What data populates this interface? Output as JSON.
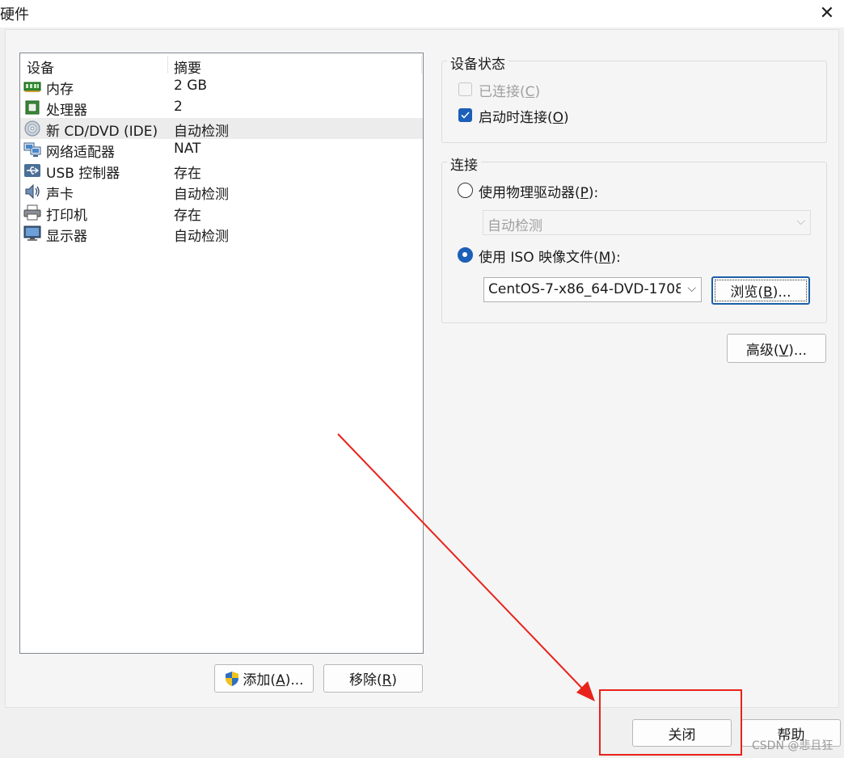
{
  "window": {
    "title": "硬件",
    "close_icon": "close-icon"
  },
  "device_list": {
    "columns": {
      "device": "设备",
      "summary": "摘要"
    },
    "items": [
      {
        "name": "内存",
        "summary": "2 GB",
        "icon": "memory-icon"
      },
      {
        "name": "处理器",
        "summary": "2",
        "icon": "processor-icon"
      },
      {
        "name": "新 CD/DVD (IDE)",
        "summary": "自动检测",
        "icon": "cd-dvd-icon",
        "selected": true
      },
      {
        "name": "网络适配器",
        "summary": "NAT",
        "icon": "network-adapter-icon"
      },
      {
        "name": "USB 控制器",
        "summary": "存在",
        "icon": "usb-icon"
      },
      {
        "name": "声卡",
        "summary": "自动检测",
        "icon": "sound-card-icon"
      },
      {
        "name": "打印机",
        "summary": "存在",
        "icon": "printer-icon"
      },
      {
        "name": "显示器",
        "summary": "自动检测",
        "icon": "display-icon"
      }
    ]
  },
  "buttons": {
    "add": {
      "text": "添加",
      "key": "A",
      "suffix": "...",
      "icon": "shield-icon"
    },
    "remove": {
      "text": "移除",
      "key": "R"
    },
    "browse": {
      "text": "浏览",
      "key": "B",
      "suffix": "..."
    },
    "advanced": {
      "text": "高级",
      "key": "V",
      "suffix": "..."
    },
    "close": "关闭",
    "help": "帮助"
  },
  "device_status": {
    "legend": "设备状态",
    "connected": {
      "text": "已连接",
      "key": "C",
      "checked": false,
      "enabled": false
    },
    "connect_on_power_on": {
      "text": "启动时连接",
      "key": "O",
      "checked": true,
      "enabled": true
    }
  },
  "connection": {
    "legend": "连接",
    "physical_drive": {
      "text": "使用物理驱动器",
      "key": "P",
      "suffix": ":",
      "selected": false,
      "dropdown_value": "自动检测"
    },
    "iso_image": {
      "text": "使用 ISO 映像文件",
      "key": "M",
      "suffix": ":",
      "selected": true,
      "file_value": "CentOS-7-x86_64-DVD-1708."
    }
  },
  "watermark": "CSDN @悲且狂",
  "colors": {
    "accent": "#1b5fb8",
    "annotation": "#e8221c"
  }
}
